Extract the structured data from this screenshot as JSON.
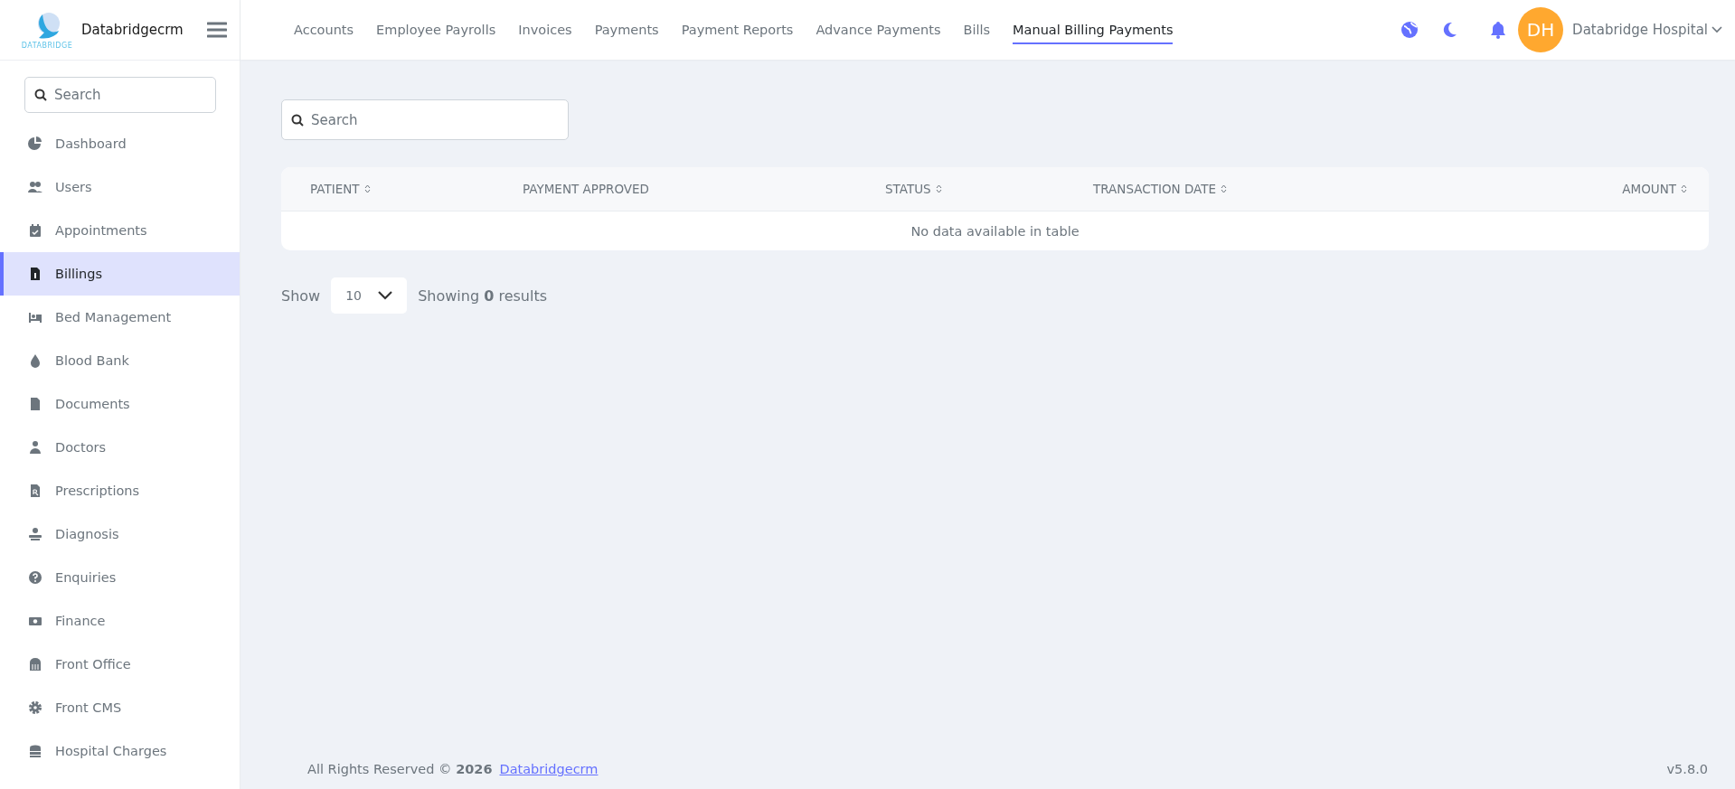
{
  "brand": {
    "logo_caption": "DATABRIDGE",
    "name": "Databridgecrm"
  },
  "sidebar": {
    "search": {
      "placeholder": "Search"
    },
    "items": [
      {
        "label": "Dashboard",
        "selected": false
      },
      {
        "label": "Users",
        "selected": false
      },
      {
        "label": "Appointments",
        "selected": false
      },
      {
        "label": "Billings",
        "selected": true
      },
      {
        "label": "Bed Management",
        "selected": false
      },
      {
        "label": "Blood Bank",
        "selected": false
      },
      {
        "label": "Documents",
        "selected": false
      },
      {
        "label": "Doctors",
        "selected": false
      },
      {
        "label": "Prescriptions",
        "selected": false
      },
      {
        "label": "Diagnosis",
        "selected": false
      },
      {
        "label": "Enquiries",
        "selected": false
      },
      {
        "label": "Finance",
        "selected": false
      },
      {
        "label": "Front Office",
        "selected": false
      },
      {
        "label": "Front CMS",
        "selected": false
      },
      {
        "label": "Hospital Charges",
        "selected": false
      }
    ]
  },
  "tabs": [
    {
      "label": "Accounts",
      "selected": false
    },
    {
      "label": "Employee Payrolls",
      "selected": false
    },
    {
      "label": "Invoices",
      "selected": false
    },
    {
      "label": "Payments",
      "selected": false
    },
    {
      "label": "Payment Reports",
      "selected": false
    },
    {
      "label": "Advance Payments",
      "selected": false
    },
    {
      "label": "Bills",
      "selected": false
    },
    {
      "label": "Manual Billing Payments",
      "selected": true
    }
  ],
  "user": {
    "initials": "DH",
    "name": "Databridge Hospital"
  },
  "search": {
    "placeholder": "Search"
  },
  "table": {
    "columns": [
      {
        "label": "PATIENT",
        "sortable": true
      },
      {
        "label": "PAYMENT APPROVED",
        "sortable": false
      },
      {
        "label": "STATUS",
        "sortable": true
      },
      {
        "label": "TRANSACTION DATE",
        "sortable": true
      },
      {
        "label": "AMOUNT",
        "sortable": true
      }
    ],
    "empty_message": "No data available in table"
  },
  "pagination": {
    "show_label": "Show",
    "page_size": "10",
    "summary": "Showing **0** results"
  },
  "footer": {
    "copyright": "All Rights Reserved © **2026**",
    "link": "Databridgecrm",
    "version": "v5.8.0"
  }
}
